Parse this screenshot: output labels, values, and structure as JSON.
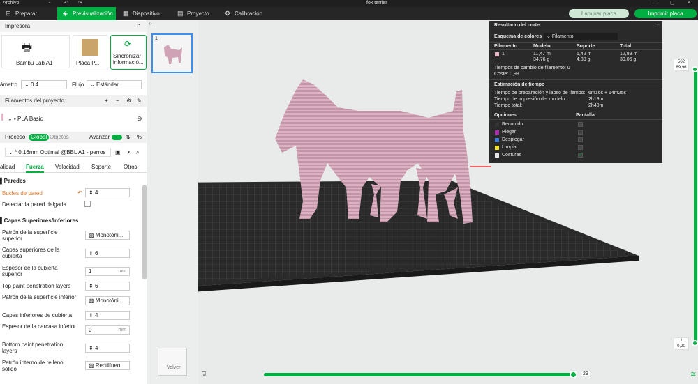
{
  "app": {
    "menu_label": "Archivo",
    "window_title": "fox terrier"
  },
  "nav": {
    "tabs": [
      {
        "label": "Preparar"
      },
      {
        "label": "Previsualización"
      },
      {
        "label": "Dispositivo"
      },
      {
        "label": "Proyecto"
      },
      {
        "label": "Calibración"
      }
    ],
    "slice_label": "Laminar placa",
    "print_label": "Imprimir placa"
  },
  "printer": {
    "section": "Impresora",
    "printer_name": "Bambu Lab A1",
    "plate_name": "Placa P...",
    "sync_line1": "Sincronizar",
    "sync_line2": "informació...",
    "diameter_label": "ámetro",
    "diameter_value": "0.4",
    "flow_label": "Flujo",
    "flow_value": "Estándar"
  },
  "filaments": {
    "section": "Filamentos del proyecto",
    "item": "PLA Basic"
  },
  "process": {
    "section": "Proceso",
    "global_label": "Global",
    "objects_label": "Objetos",
    "advanced_label": "Avanzar",
    "profile": "* 0.16mm Optimal @BBL A1 - perros",
    "tabs": [
      "alidad",
      "Fuerza",
      "Velocidad",
      "Soporte",
      "Otros"
    ]
  },
  "walls": {
    "group": "Paredes",
    "loops_label": "Bucles de pared",
    "loops_value": "4",
    "detect_thin_label": "Detectar la pared delgada"
  },
  "shells": {
    "group": "Capas Superiores/Inferiores",
    "rows": [
      {
        "label": "Patrón de la superficie superior",
        "value": "Monotóni..."
      },
      {
        "label": "Capas superiores de la cubierta",
        "value": "6"
      },
      {
        "label": "Espesor de la cubierta superior",
        "value": "1",
        "unit": "mm"
      },
      {
        "label": "Top paint penetration layers",
        "value": "6"
      },
      {
        "label": "Patrón de la superficie inferior",
        "value": "Monotóni..."
      },
      {
        "label": "Capas inferiores de cubierta",
        "value": "4"
      },
      {
        "label": "Espesor de la carcasa inferior",
        "value": "0",
        "unit": "mm"
      },
      {
        "label": "Bottom paint penetration layers",
        "value": "4"
      },
      {
        "label": "Patrón interno de relleno sólido",
        "value": "Rectilíneo"
      }
    ]
  },
  "plate_thumb": {
    "number": "1"
  },
  "result": {
    "title": "Resultado del corte",
    "scheme_label": "Esquema de colores",
    "scheme_value": "Filamento",
    "headers": [
      "Filamento",
      "Modelo",
      "Soporte",
      "Total"
    ],
    "row": {
      "id": "1",
      "model_len": "11,47 m",
      "model_wt": "34,76 g",
      "support_len": "1,42 m",
      "support_wt": "4,30 g",
      "total_len": "12,89 m",
      "total_wt": "39,06 g"
    },
    "change_time": "Tiempos de cambio de filamento:  0",
    "cost": "Coste:  0,98",
    "estimate_title": "Estimación de tiempo",
    "times": [
      {
        "label": "Tiempo de preparación y lapso de tiempo:",
        "value": "6m16s + 14m25s"
      },
      {
        "label": "Tiempo de impresión del modelo:",
        "value": "2h19m"
      },
      {
        "label": "Tiempo total:",
        "value": "2h40m"
      }
    ],
    "options_header": "Opciones",
    "display_header": "Pantalla",
    "options": [
      {
        "label": "Recorrido",
        "color": "#333333"
      },
      {
        "label": "Plegar",
        "color": "#b02bb0"
      },
      {
        "label": "Desplegar",
        "color": "#3a7bd5"
      },
      {
        "label": "Limpiar",
        "color": "#f2e422"
      },
      {
        "label": "Costuras",
        "color": "#e8e8e8"
      }
    ]
  },
  "layer_slider": {
    "top_value": "562",
    "top_height": "89,96",
    "bottom_value": "1",
    "bottom_height": "0,20"
  },
  "move_slider": {
    "value": "29"
  },
  "viewcube": {
    "label": "Volver"
  },
  "colors": {
    "accent": "#00ae42",
    "model": "#cfa3b5"
  }
}
